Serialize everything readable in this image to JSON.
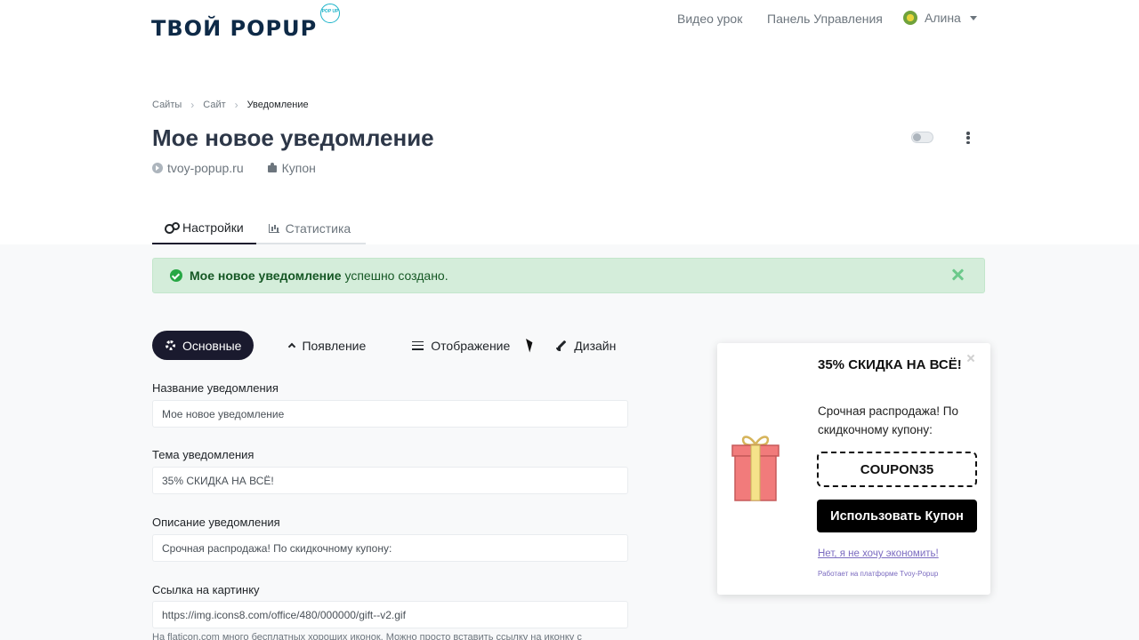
{
  "header": {
    "logo_text": "ТВОЙ POPUP",
    "logo_badge": "POP UP",
    "nav": [
      "Видео урок",
      "Панель Управления"
    ],
    "user_name": "Алина"
  },
  "breadcrumb": [
    "Сайты",
    "Сайт",
    "Уведомление"
  ],
  "page": {
    "title": "Мое новое уведомление",
    "site": "tvoy-popup.ru",
    "type": "Купон"
  },
  "main_tabs": [
    {
      "label": "Настройки",
      "icon": "gears-icon"
    },
    {
      "label": "Статистика",
      "icon": "bar-chart-icon"
    }
  ],
  "alert": {
    "strong": "Мое новое уведомление",
    "text": "успешно создано."
  },
  "sub_tabs": [
    {
      "label": "Основные",
      "icon": "cog-icon"
    },
    {
      "label": "Появление",
      "icon": "chevron-up-icon"
    },
    {
      "label": "Отображение",
      "icon": "sliders-icon"
    },
    {
      "label": "Дизайн",
      "icon": "paint-brush-icon"
    }
  ],
  "form": {
    "name_label": "Название уведомления",
    "name_value": "Мое новое уведомление",
    "theme_label": "Тема уведомления",
    "theme_value": "35% СКИДКА НА ВСЁ!",
    "desc_label": "Описание уведомления",
    "desc_value": "Срочная распродажа! По скидкочному купону:",
    "image_label": "Ссылка на картинку",
    "image_value": "https://img.icons8.com/office/480/000000/gift--v2.gif",
    "image_hint": "На flaticon.com много бесплатных хороших иконок. Можно просто вставить ссылку на иконку с"
  },
  "preview": {
    "title": "35% СКИДКА НА ВСЁ!",
    "description": "Срочная распродажа! По скидкочному купону:",
    "coupon": "COUPON35",
    "button": "Использовать Купон",
    "decline": "Нет, я не хочу экономить!",
    "powered": "Работает на платформе Tvoy-Popup"
  },
  "colors": {
    "accent": "#1a1a2e",
    "success_bg": "#d4edda",
    "success_text": "#155724",
    "link_purple": "#7b6bc0"
  }
}
